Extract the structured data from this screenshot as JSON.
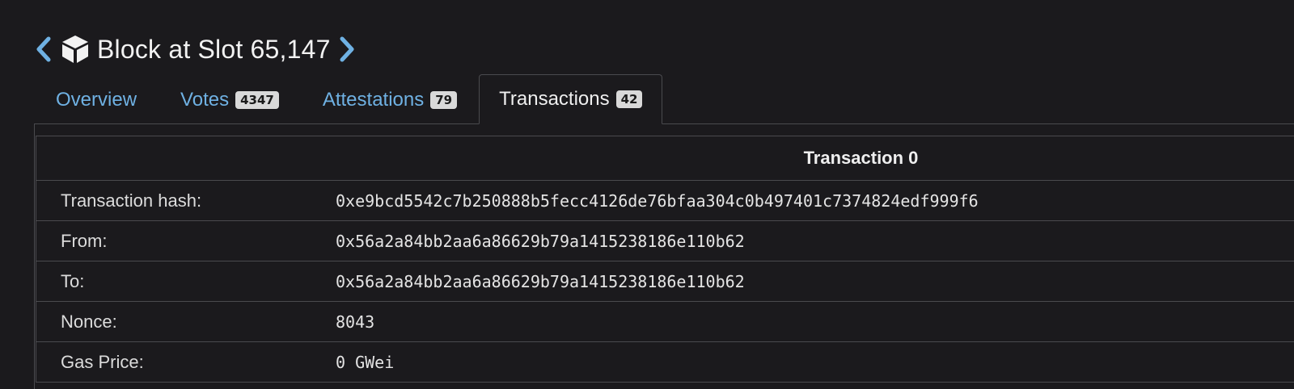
{
  "header": {
    "title": "Block at Slot 65,147",
    "prev_icon": "chevron-left-icon",
    "next_icon": "chevron-right-icon",
    "block_icon": "cube-icon",
    "accent_color": "#6fb1e3"
  },
  "tabs": [
    {
      "label": "Overview",
      "badge": "",
      "active": false
    },
    {
      "label": "Votes",
      "badge": "4347",
      "active": false
    },
    {
      "label": "Attestations",
      "badge": "79",
      "active": false
    },
    {
      "label": "Transactions",
      "badge": "42",
      "active": true
    }
  ],
  "transaction": {
    "title": "Transaction 0",
    "rows": [
      {
        "label": "Transaction hash:",
        "value": "0xe9bcd5542c7b250888b5fecc4126de76bfaa304c0b497401c7374824edf999f6"
      },
      {
        "label": "From:",
        "value": "0x56a2a84bb2aa6a86629b79a1415238186e110b62"
      },
      {
        "label": "To:",
        "value": "0x56a2a84bb2aa6a86629b79a1415238186e110b62"
      },
      {
        "label": "Nonce:",
        "value": "8043"
      },
      {
        "label": "Gas Price:",
        "value": "0 GWei"
      }
    ]
  }
}
